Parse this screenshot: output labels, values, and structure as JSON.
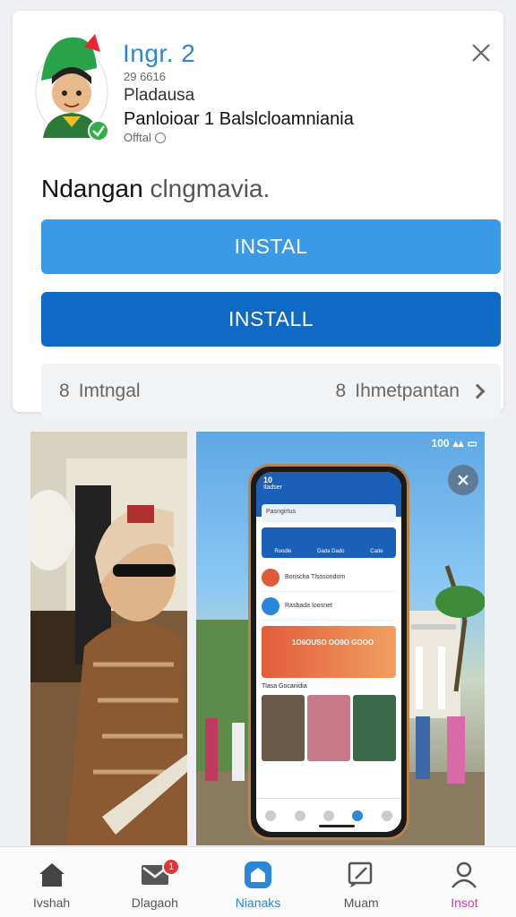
{
  "app": {
    "name": "Ingr. 2",
    "meta1": "29 6616",
    "meta2": "Pladausa",
    "meta3": "Panloioar 1 Balslcloamniania",
    "meta4": "Offtal"
  },
  "headline": {
    "main": "Ndangan",
    "soft": "clngmavia."
  },
  "buttons": {
    "install_primary": "INSTAL",
    "install_secondary": "INSTALL"
  },
  "info_row": {
    "left_num": "8",
    "left_label": "Imtngal",
    "right_num": "8",
    "right_label": "Ihmetpantan"
  },
  "shot_right": {
    "status": "100",
    "phone": {
      "time": "10",
      "header": "Iladser",
      "search": "Pasngirtus",
      "tabs": [
        "Roodle",
        "Dada Dado",
        "Cade"
      ],
      "items": [
        "Bonscha Tlsosondom",
        "Rasbada Ioosnet"
      ],
      "banner": "1O6OUSO\nOO9O GOOO",
      "subtitle": "Tlasa Gocanidia"
    }
  },
  "nav": [
    {
      "label": "Ivshah",
      "icon": "home-icon"
    },
    {
      "label": "Dlagaoh",
      "icon": "mail-icon",
      "badge": "1"
    },
    {
      "label": "Nianaks",
      "icon": "shop-icon",
      "active": true
    },
    {
      "label": "Muam",
      "icon": "edit-icon"
    },
    {
      "label": "Insot",
      "icon": "user-icon"
    }
  ],
  "colors": {
    "primary": "#3a9ae8",
    "primary_dark": "#0f6ac5",
    "accent_pink": "#d23ab2",
    "verify_green": "#2fae4a"
  }
}
